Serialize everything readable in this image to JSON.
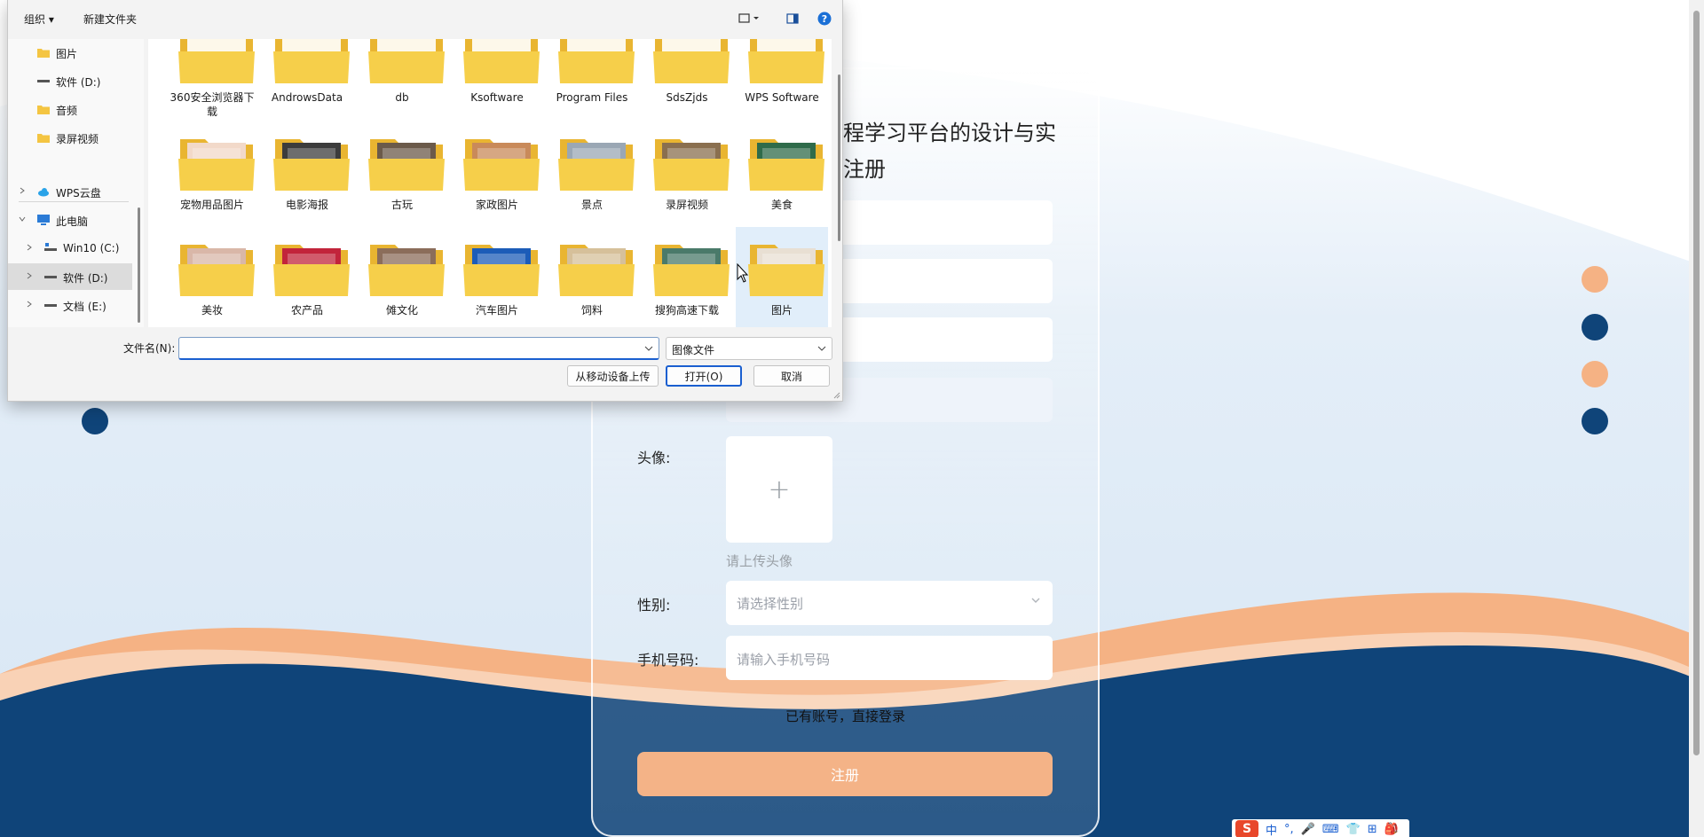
{
  "page": {
    "title_line1": "程学习平台的设计与实",
    "title_line2": "注册",
    "avatar_label": "头像:",
    "avatar_hint": "请上传头像",
    "gender_label": "性别:",
    "gender_placeholder": "请选择性别",
    "phone_label": "手机号码:",
    "phone_placeholder": "请输入手机号码",
    "login_link": "已有账号，直接登录",
    "register_button": "注册",
    "colors": {
      "accent": "#f4b387",
      "navy": "#0f4479",
      "wave_orange": "#f5b284"
    }
  },
  "ime": {
    "logo": "S",
    "items": [
      "中",
      "°,",
      "🎤",
      "⌨",
      "👕",
      "⊞",
      "🎒"
    ]
  },
  "dialog": {
    "toolbar": {
      "organize": "组织 ▾",
      "new_folder": "新建文件夹"
    },
    "nav": [
      {
        "label": "图片",
        "icon": "folder-icon"
      },
      {
        "label": "软件 (D:)",
        "icon": "drive-icon"
      },
      {
        "label": "音频",
        "icon": "folder-icon"
      },
      {
        "label": "录屏视频",
        "icon": "folder-icon"
      },
      {
        "label": "WPS云盘",
        "icon": "cloud-icon"
      },
      {
        "label": "此电脑",
        "icon": "pc-icon"
      },
      {
        "label": "Win10 (C:)",
        "icon": "windows-drive-icon"
      },
      {
        "label": "软件 (D:)",
        "icon": "drive-icon"
      },
      {
        "label": "文档 (E:)",
        "icon": "drive-icon"
      }
    ],
    "folders_row1": [
      "360安全浏览器下载",
      "AndrowsData",
      "db",
      "Ksoftware",
      "Program Files",
      "SdsZjds",
      "WPS Software"
    ],
    "folders_row2": [
      "宠物用品图片",
      "电影海报",
      "古玩",
      "家政图片",
      "景点",
      "录屏视频",
      "美食"
    ],
    "folders_row3": [
      "美妆",
      "农产品",
      "傩文化",
      "汽车图片",
      "饲料",
      "搜狗高速下载",
      "图片"
    ],
    "filename_label": "文件名(N):",
    "filename_value": "",
    "filetype": "图像文件",
    "upload_mobile": "从移动设备上传",
    "open": "打开(O)",
    "cancel": "取消"
  }
}
